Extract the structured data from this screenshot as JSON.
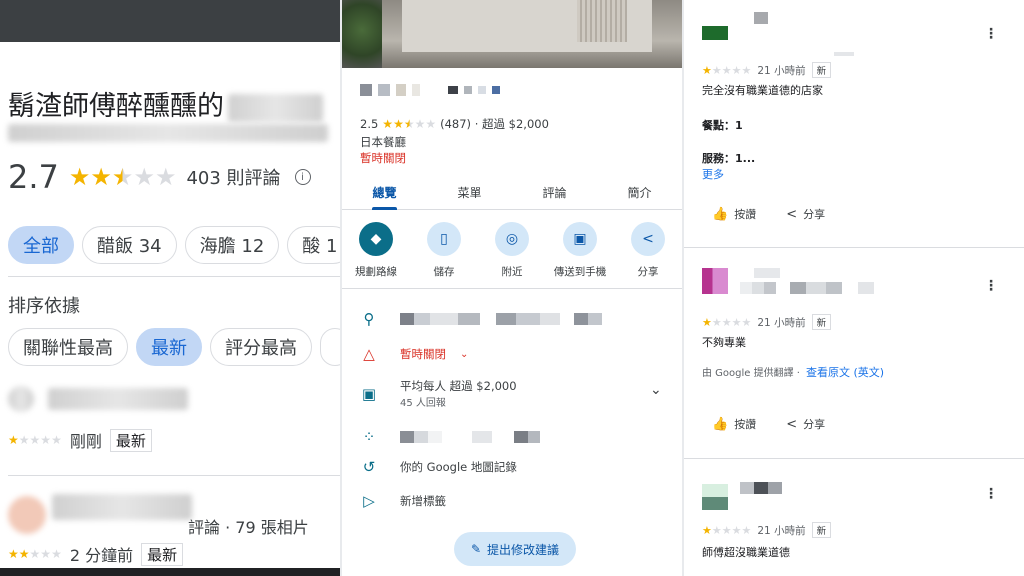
{
  "panel1": {
    "title": "鬍渣師傅醉醺醺的",
    "rating": "2.7",
    "rating_value": 2.7,
    "review_count": "403 則評論",
    "filters": [
      {
        "label": "全部",
        "selected": true
      },
      {
        "label": "醋飯 34",
        "selected": false
      },
      {
        "label": "海膽 12",
        "selected": false
      },
      {
        "label": "酸 1",
        "selected": false
      }
    ],
    "sort_label": "排序依據",
    "sort_options": [
      {
        "label": "關聯性最高",
        "selected": false
      },
      {
        "label": "最新",
        "selected": true
      },
      {
        "label": "評分最高",
        "selected": false
      },
      {
        "label": "",
        "selected": false
      }
    ],
    "reviews": [
      {
        "stars": 1,
        "time": "剛剛",
        "tag": "最新",
        "meta": ""
      },
      {
        "stars": 2,
        "time": "2 分鐘前",
        "tag": "最新",
        "meta": "評論 · 79 張相片"
      }
    ]
  },
  "panel2": {
    "rating_text": "2.5",
    "rating_value": 2.5,
    "review_meta": "(487) · 超過 $2,000",
    "category": "日本餐廳",
    "status": "暫時關閉",
    "tabs": [
      {
        "label": "總覽",
        "active": true
      },
      {
        "label": "菜單",
        "active": false
      },
      {
        "label": "評論",
        "active": false
      },
      {
        "label": "簡介",
        "active": false
      }
    ],
    "actions": [
      {
        "label": "規劃路線",
        "icon": "directions-icon",
        "glyph": "◆"
      },
      {
        "label": "儲存",
        "icon": "bookmark-icon",
        "glyph": "▯"
      },
      {
        "label": "附近",
        "icon": "nearby-icon",
        "glyph": "◎"
      },
      {
        "label": "傳送到手機",
        "icon": "send-to-phone-icon",
        "glyph": "▣"
      },
      {
        "label": "分享",
        "icon": "share-icon",
        "glyph": "<"
      }
    ],
    "closed_row": "暫時關閉",
    "price_row": "平均每人 超過 $2,000",
    "price_sub": "45 人回報",
    "history_row": "你的 Google 地圖記錄",
    "label_row": "新增標籤",
    "suggest_button": "提出修改建議"
  },
  "panel3": {
    "reviews": [
      {
        "stars": 1,
        "time": "21 小時前",
        "tag": "新",
        "text": "完全沒有職業道德的店家",
        "meals": "餐點：1",
        "service": "服務：1...",
        "more": "更多",
        "like": "按讚",
        "share": "分享"
      },
      {
        "stars": 1,
        "time": "21 小時前",
        "tag": "新",
        "text": "不夠專業",
        "translated_by": "由 Google 提供翻譯 ·",
        "original_link": "查看原文 (英文)",
        "like": "按讚",
        "share": "分享"
      },
      {
        "stars": 1,
        "time": "21 小時前",
        "tag": "新",
        "text": "師傅超沒職業道德"
      }
    ]
  },
  "colors": {
    "accent_blue": "#0b57a8",
    "closed_red": "#d93025",
    "star_gold": "#f4b400",
    "chip_selected": "#c2d7f5"
  }
}
